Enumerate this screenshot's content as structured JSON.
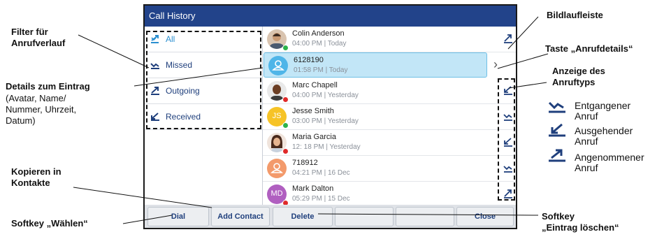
{
  "screen": {
    "title": "Call History",
    "filters": [
      {
        "label": "All",
        "icon": "all-calls-icon",
        "selected": true
      },
      {
        "label": "Missed",
        "icon": "missed-call-icon",
        "selected": false
      },
      {
        "label": "Outgoing",
        "icon": "outgoing-call-icon",
        "selected": false
      },
      {
        "label": "Received",
        "icon": "received-call-icon",
        "selected": false
      }
    ],
    "entries": [
      {
        "name": "Colin Anderson",
        "meta": "04:00 PM | Today",
        "avatar": "photo",
        "status": "#2cb34a",
        "calltype": "outgoing"
      },
      {
        "name": "6128190",
        "meta": "01:58 PM | Today",
        "avatar": "placeholder",
        "status": "",
        "calltype": "details"
      },
      {
        "name": "Marc Chapell",
        "meta": "04:00 PM | Yesterday",
        "avatar": "photo",
        "status": "#e02a2a",
        "calltype": "received"
      },
      {
        "name": "Jesse Smith",
        "meta": "03:00 PM | Yesterday",
        "avatar": "initials",
        "initials": "JS",
        "status": "#2cb34a",
        "calltype": "missed"
      },
      {
        "name": "Maria Garcia",
        "meta": "12: 18 PM | Yesterday",
        "avatar": "photo",
        "status": "#e02a2a",
        "calltype": "received"
      },
      {
        "name": "718912",
        "meta": "04:21 PM | 16 Dec",
        "avatar": "placeholder",
        "status": "",
        "calltype": "missed"
      },
      {
        "name": "Mark Dalton",
        "meta": "05:29 PM | 15 Dec",
        "avatar": "initials",
        "initials": "MD",
        "status": "#e02a2a",
        "calltype": "outgoing"
      }
    ],
    "softkeys": [
      "Dial",
      "Add Contact",
      "Delete",
      "",
      "",
      "Close"
    ]
  },
  "callouts": {
    "filter": "Filter für\nAnrufverlauf",
    "details_title": "Details zum Eintrag",
    "details_sub": "(Avatar, Name/\nNummer, Uhrzeit,\nDatum)",
    "copy": "Kopieren in\nKontakte",
    "dial_softkey": "Softkey „Wählen“",
    "scrollbar": "Bildlaufleiste",
    "call_details_key": "Taste „Anrufdetails“",
    "calltype_display": "Anzeige des\nAnruftyps",
    "delete_softkey": "Softkey\n„Eintrag löschen“"
  },
  "legend": [
    {
      "label": "Entgangener\nAnruf",
      "icon": "missed-call-legend-icon"
    },
    {
      "label": "Ausgehender\nAnruf",
      "icon": "outgoing-call-legend-icon"
    },
    {
      "label": "Angenommener\nAnruf",
      "icon": "received-call-legend-icon"
    }
  ],
  "colors": {
    "titlebar": "#22438a",
    "accent": "#2a8fd0",
    "highlight": "#c2e6f7"
  }
}
